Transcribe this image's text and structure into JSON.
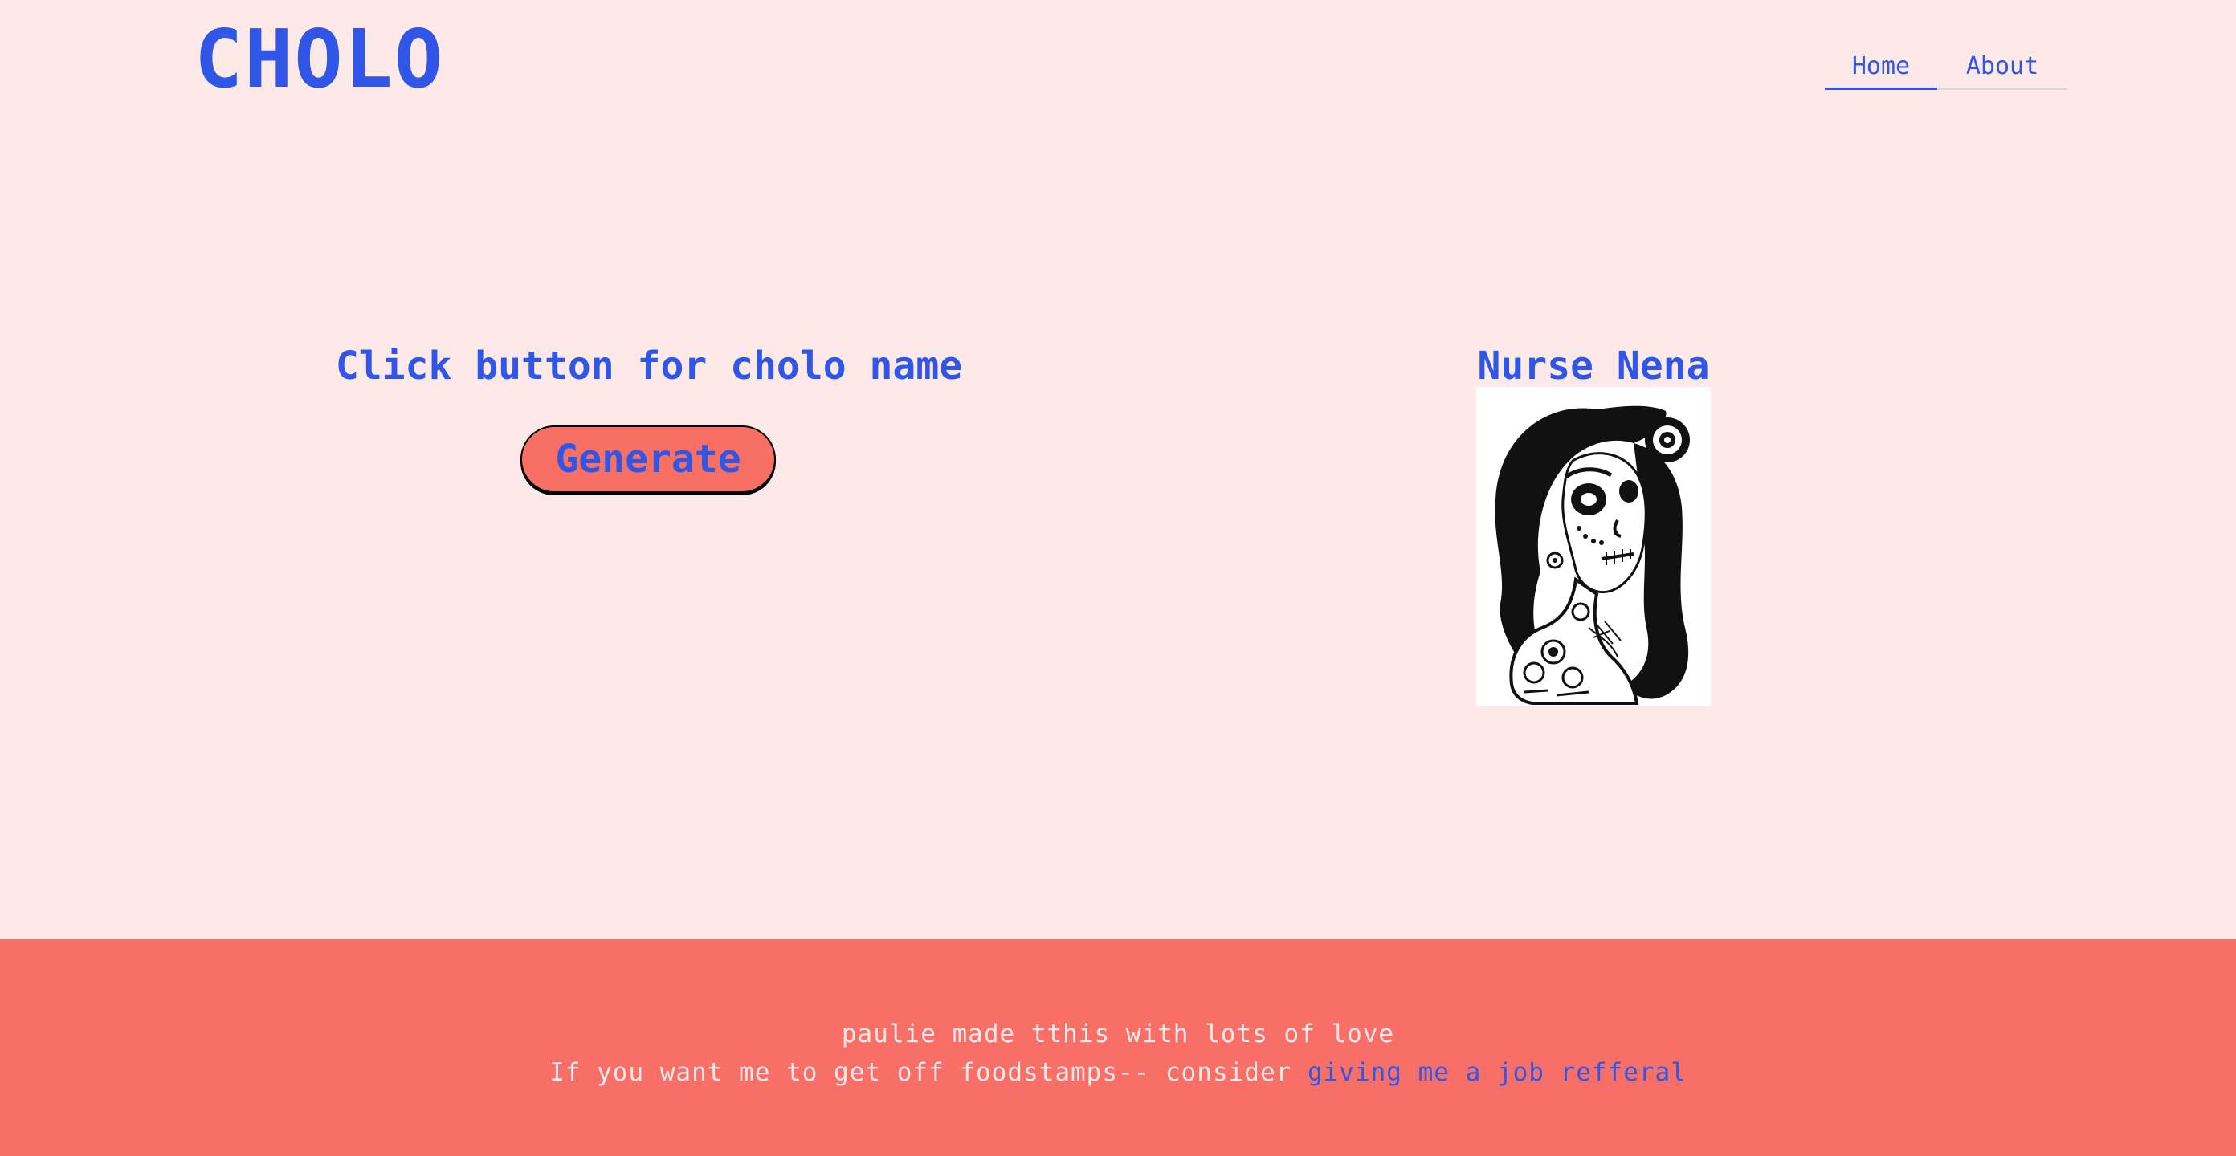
{
  "header": {
    "logo": "CHOLO",
    "nav": [
      {
        "label": "Home",
        "active": true
      },
      {
        "label": "About",
        "active": false
      }
    ]
  },
  "main": {
    "prompt": "Click button for cholo name",
    "generate_label": "Generate",
    "result_name": "Nurse Nena",
    "portrait_icon": "sugar-skull-woman-illustration"
  },
  "footer": {
    "line1": "paulie made tthis with lots of love",
    "line2_text": "If you want me to get off foodstamps-- consider ",
    "line2_link": "giving me a job refferal"
  },
  "colors": {
    "background": "#fde9e8",
    "accent": "#2f56e6",
    "button": "#f86f63",
    "footer": "#f86f67"
  }
}
